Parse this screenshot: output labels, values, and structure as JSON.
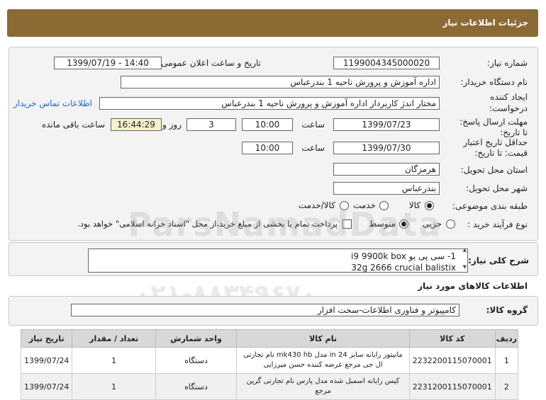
{
  "title": "جزئیات اطلاعات نیاز",
  "form": {
    "need_no_label": "شماره نیاز:",
    "need_no": "1199004345000020",
    "announce_label": "تاریخ و ساعت اعلان عمومی:",
    "announce_value": "1399/07/19 - 14:40",
    "buyer_label": "نام دستگاه خریدار:",
    "buyer_value": "اداره آموزش و پرورش ناحیه 1 بندرعباس",
    "creator_label_1": "ایجاد کننده",
    "creator_label_2": "درخواست:",
    "creator_value": "مختار اندژ کاربرداز اداره آموزش و پرورش ناحیه 1 بندرعباس",
    "contact_link": "اطلاعات تماس خریدار",
    "reply_label_1": "مهلت ارسال پاسخ:",
    "reply_label_2": "تا تاریخ:",
    "reply_date": "1399/07/23",
    "time_label": "ساعت",
    "reply_time": "10:00",
    "days_value": "3",
    "days_label": "روز و",
    "remaining_value": "16:44:29",
    "remaining_label": "ساعت باقی مانده",
    "validity_label_1": "حداقل تاریخ اعتبار",
    "validity_label_2": "قیمت: تا تاریخ:",
    "validity_date": "1399/07/30",
    "validity_time": "10:00",
    "province_label": "استان محل تحویل:",
    "province_value": "هرمزگان",
    "city_label": "شهر محل تحویل:",
    "city_value": "بندرعباس",
    "category_label": "طبقه بندی موضوعی:",
    "cat_options": [
      "کالا",
      "خدمت",
      "کالا/خدمت"
    ],
    "process_label": "نوع فرآیند خرید :",
    "process_options": [
      "جزیی",
      "متوسط"
    ],
    "payment_note": "پرداخت تمام یا بخشی از مبلغ خرید،از محل \"اسناد خزانه اسلامی\" خواهد بود."
  },
  "description": {
    "label": "شرح کلی نیاز:",
    "line1": "1- سی پی یو i9  9900k box",
    "line2": "32g 2666 crucial balistix"
  },
  "goods_title": "اطلاعات کالاهای مورد نیاز",
  "group": {
    "label": "گروه کالا:",
    "value": "کامپیوتر و فناوری اطلاعات-سخت افزار"
  },
  "table": {
    "headers": [
      "ردیف",
      "کد کالا",
      "نام کالا",
      "واحد شمارش",
      "تعداد / مقدار",
      "تاریخ نیاز"
    ],
    "rows": [
      {
        "row": "1",
        "code": "2232200115070001",
        "name": "مانیتور رایانه سایز 24 in مدل mk430 hb نام تجارتی ال جی مرجع عرضه کننده حسن میرزایی",
        "unit": "دستگاه",
        "qty": "1",
        "date": "1399/07/24"
      },
      {
        "row": "2",
        "code": "2231200115070001",
        "name": "کیس رایانه اسمبل شده مدل پارس نام تجارتی گرین مرجع",
        "unit": "دستگاه",
        "qty": "1",
        "date": "1399/07/24"
      }
    ]
  },
  "watermark": {
    "line1": "ParsNamadData",
    "line2": "۰۲۱-۸۸۳۴۹۶۷۰"
  }
}
